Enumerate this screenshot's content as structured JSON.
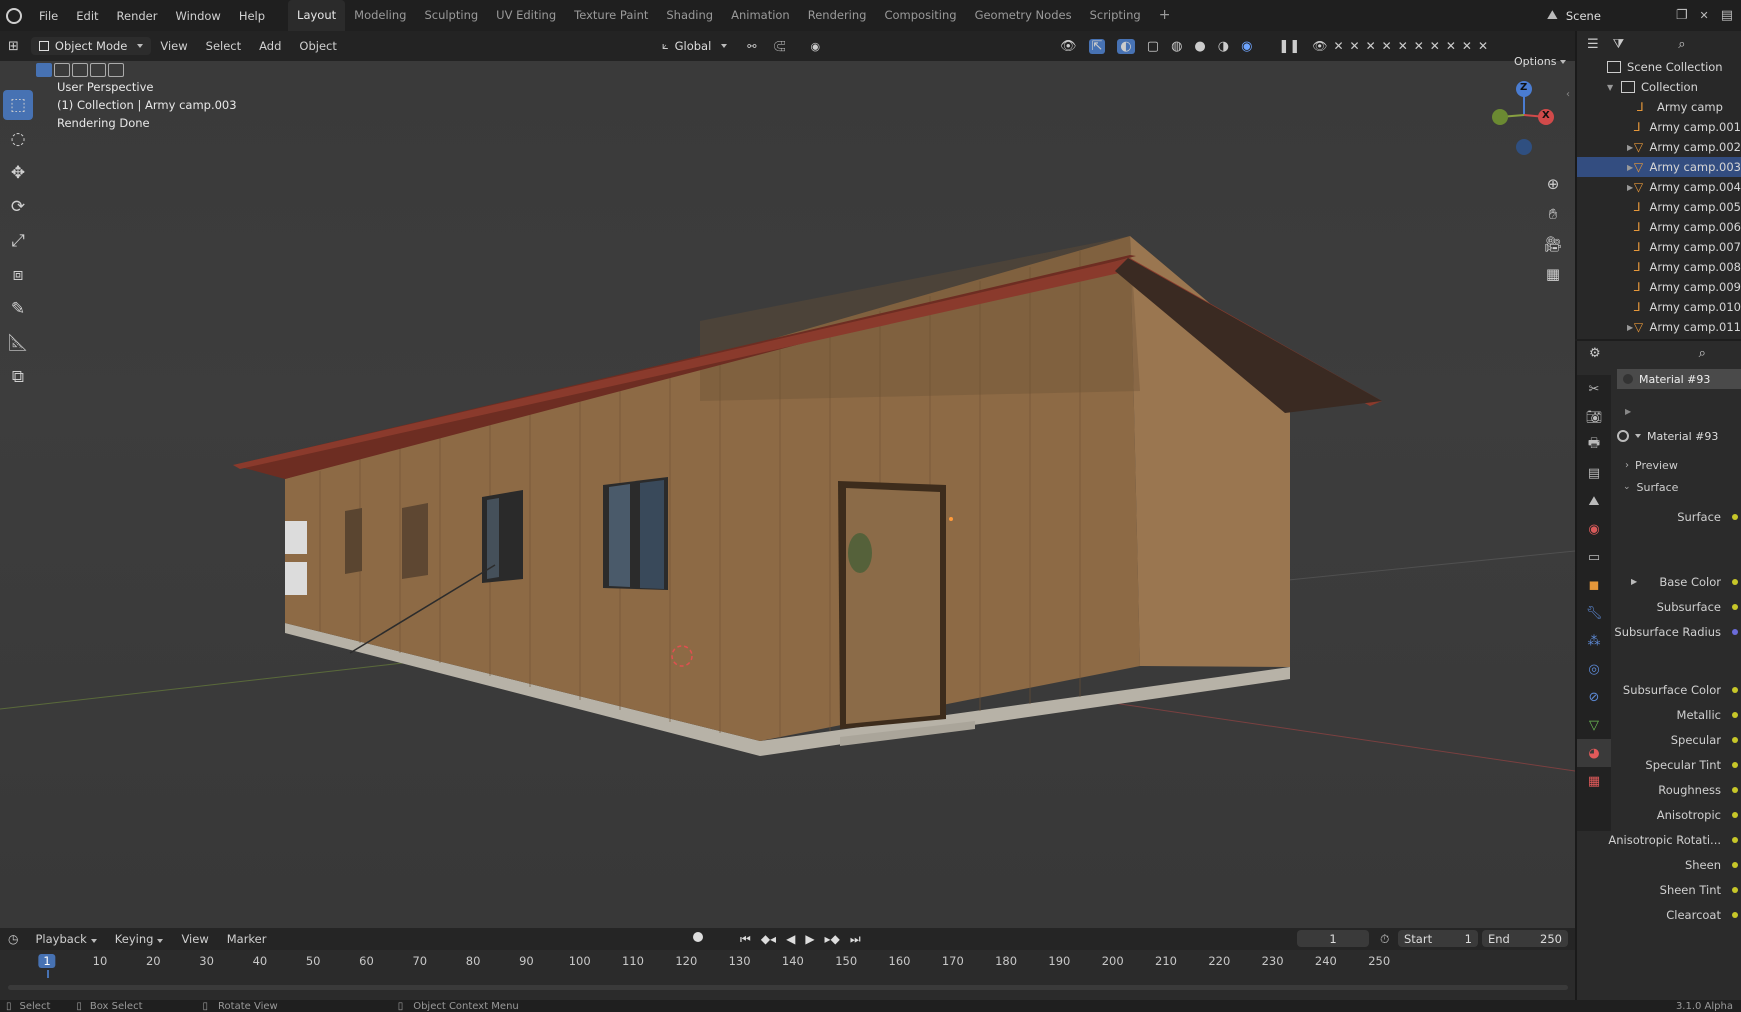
{
  "menu": [
    "File",
    "Edit",
    "Render",
    "Window",
    "Help"
  ],
  "workspaces": [
    {
      "label": "Layout",
      "active": true
    },
    {
      "label": "Modeling"
    },
    {
      "label": "Sculpting"
    },
    {
      "label": "UV Editing"
    },
    {
      "label": "Texture Paint"
    },
    {
      "label": "Shading"
    },
    {
      "label": "Animation"
    },
    {
      "label": "Rendering"
    },
    {
      "label": "Compositing"
    },
    {
      "label": "Geometry Nodes"
    },
    {
      "label": "Scripting"
    }
  ],
  "add_workspace": "+",
  "scene_label": "Scene",
  "header": {
    "mode": "Object Mode",
    "view": "View",
    "select": "Select",
    "add": "Add",
    "object": "Object",
    "transform_orientation": "Global",
    "options": "Options"
  },
  "viewport_info": {
    "line1": "User Perspective",
    "line2": "(1) Collection | Army camp.003",
    "line3": "Rendering Done"
  },
  "gizmo": {
    "z": "Z",
    "x": "X"
  },
  "outliner": {
    "scene_collection": "Scene Collection",
    "collection": "Collection",
    "items": [
      {
        "name": "Army camp",
        "expand": false,
        "icon": "empty"
      },
      {
        "name": "Army camp.001",
        "expand": false,
        "icon": "empty"
      },
      {
        "name": "Army camp.002",
        "expand": true,
        "icon": "mesh"
      },
      {
        "name": "Army camp.003",
        "expand": true,
        "icon": "mesh",
        "selected": true
      },
      {
        "name": "Army camp.004",
        "expand": true,
        "icon": "mesh"
      },
      {
        "name": "Army camp.005",
        "expand": false,
        "icon": "empty"
      },
      {
        "name": "Army camp.006",
        "expand": false,
        "icon": "empty"
      },
      {
        "name": "Army camp.007",
        "expand": false,
        "icon": "empty"
      },
      {
        "name": "Army camp.008",
        "expand": false,
        "icon": "empty"
      },
      {
        "name": "Army camp.009",
        "expand": false,
        "icon": "empty"
      },
      {
        "name": "Army camp.010",
        "expand": false,
        "icon": "empty"
      },
      {
        "name": "Army camp.011",
        "expand": true,
        "icon": "mesh"
      }
    ]
  },
  "properties": {
    "material_slot": "Material #93",
    "material_name": "Material #93",
    "preview": "Preview",
    "surface_panel": "Surface",
    "rows": [
      "Surface",
      "Base Color",
      "Subsurface",
      "Subsurface Radius",
      "Subsurface Color",
      "Metallic",
      "Specular",
      "Specular Tint",
      "Roughness",
      "Anisotropic",
      "Anisotropic Rotati...",
      "Sheen",
      "Sheen Tint",
      "Clearcoat"
    ]
  },
  "timeline": {
    "playback": "Playback",
    "keying": "Keying",
    "view": "View",
    "marker": "Marker",
    "current_frame": "1",
    "start_label": "Start",
    "start": "1",
    "end_label": "End",
    "end": "250",
    "ticks": [
      "1",
      "10",
      "20",
      "30",
      "40",
      "50",
      "60",
      "70",
      "80",
      "90",
      "100",
      "110",
      "120",
      "130",
      "140",
      "150",
      "160",
      "170",
      "180",
      "190",
      "200",
      "210",
      "220",
      "230",
      "240",
      "250"
    ]
  },
  "status": {
    "select": "Select",
    "box_select": "Box Select",
    "rotate_view": "Rotate View",
    "context_menu": "Object Context Menu",
    "version": "3.1.0 Alpha"
  },
  "colors": {
    "accent": "#4772b3",
    "selected_row": "#334d80",
    "roof": "#8a3a2c",
    "wall": "#8d6a45"
  }
}
